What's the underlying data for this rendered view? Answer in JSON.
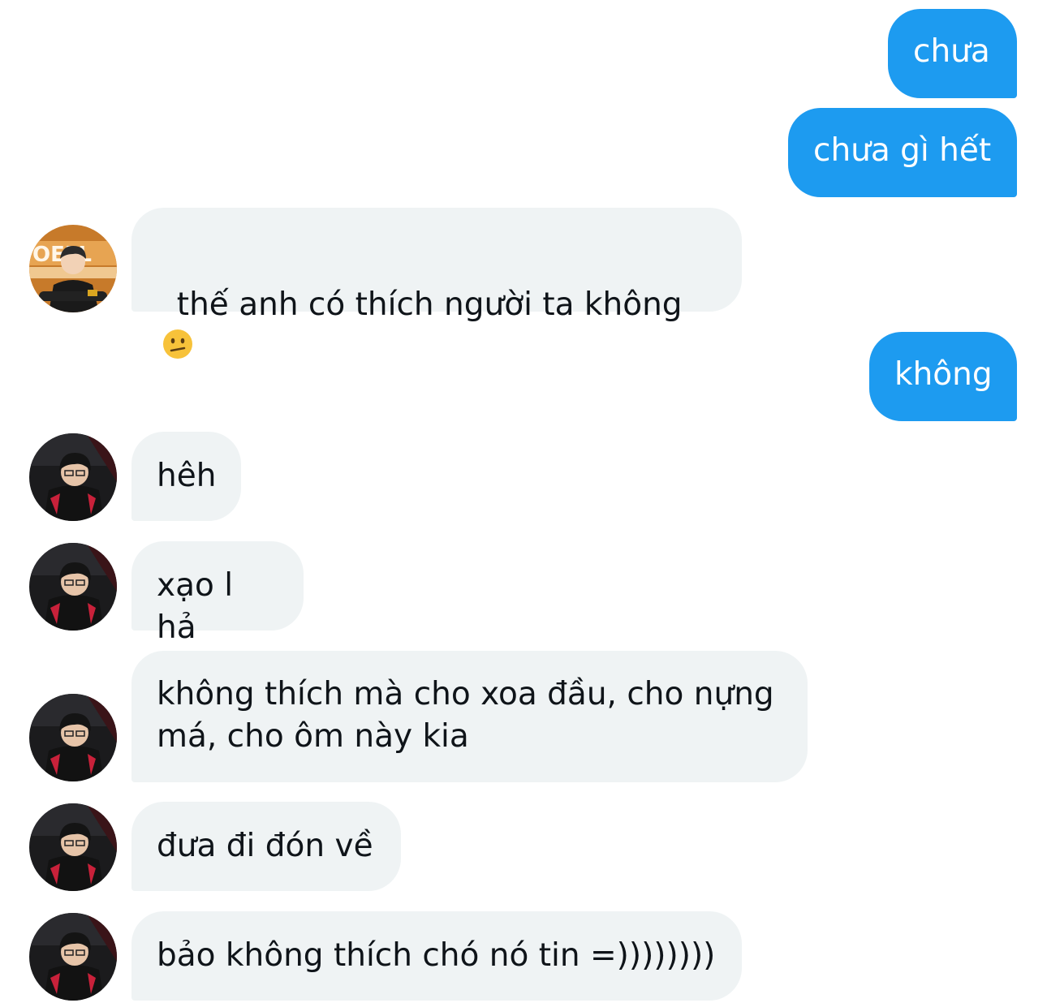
{
  "conversation": {
    "messages": [
      {
        "sender": "me",
        "text": "chưa"
      },
      {
        "sender": "me",
        "text": "chưa gì hết"
      },
      {
        "sender": "them",
        "text": "thế anh có thích người ta không",
        "emoji": "confused-face"
      },
      {
        "sender": "me",
        "text": "không"
      },
      {
        "sender": "them",
        "text": "hêh"
      },
      {
        "sender": "them",
        "text": "xạo l hả"
      },
      {
        "sender": "them",
        "text": "không thích mà cho xoa đầu, cho nựng\nmá, cho ôm này kia"
      },
      {
        "sender": "them",
        "text": "đưa đi đón về"
      },
      {
        "sender": "them",
        "text": "bảo không thích chó nó tin =))))))))"
      }
    ]
  },
  "colors": {
    "sent_bubble": "#1d9bf0",
    "received_bubble": "#eff3f4",
    "received_text": "#0f1419",
    "sent_text": "#ffffff"
  }
}
